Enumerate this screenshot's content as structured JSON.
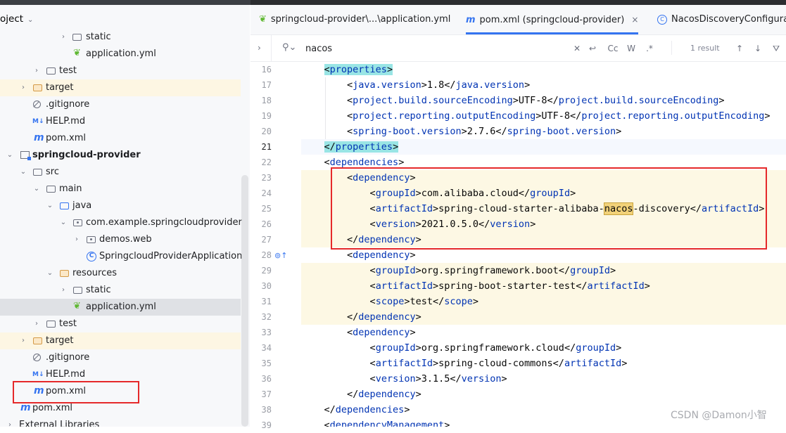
{
  "project_panel": {
    "title": "oject",
    "rows": [
      {
        "label": "static",
        "icon": "folder-icon",
        "arrow": "›"
      },
      {
        "label": "application.yml",
        "icon": "yaml-icon",
        "arrow": ""
      },
      {
        "label": "test",
        "icon": "folder-icon",
        "arrow": "›"
      },
      {
        "label": "target",
        "icon": "excluded-folder-icon",
        "arrow": "›"
      },
      {
        "label": ".gitignore",
        "icon": "ignore-icon",
        "arrow": ""
      },
      {
        "label": "HELP.md",
        "icon": "markdown-icon",
        "arrow": ""
      },
      {
        "label": "pom.xml",
        "icon": "maven-icon",
        "arrow": ""
      },
      {
        "label": "springcloud-provider",
        "icon": "module-icon",
        "arrow": "⌄"
      },
      {
        "label": "src",
        "icon": "folder-icon",
        "arrow": "⌄"
      },
      {
        "label": "main",
        "icon": "folder-icon",
        "arrow": "⌄"
      },
      {
        "label": "java",
        "icon": "source-folder-icon",
        "arrow": "⌄"
      },
      {
        "label": "com.example.springcloudprovider",
        "icon": "package-icon",
        "arrow": "⌄"
      },
      {
        "label": "demos.web",
        "icon": "package-icon",
        "arrow": "›"
      },
      {
        "label": "SpringcloudProviderApplication",
        "icon": "class-icon",
        "arrow": ""
      },
      {
        "label": "resources",
        "icon": "resources-folder-icon",
        "arrow": "⌄"
      },
      {
        "label": "static",
        "icon": "folder-icon",
        "arrow": "›"
      },
      {
        "label": "application.yml",
        "icon": "yaml-icon",
        "arrow": ""
      },
      {
        "label": "test",
        "icon": "folder-icon",
        "arrow": "›"
      },
      {
        "label": "target",
        "icon": "excluded-folder-icon",
        "arrow": "›"
      },
      {
        "label": ".gitignore",
        "icon": "ignore-icon",
        "arrow": ""
      },
      {
        "label": "HELP.md",
        "icon": "markdown-icon",
        "arrow": ""
      },
      {
        "label": "pom.xml",
        "icon": "maven-icon",
        "arrow": ""
      },
      {
        "label": "pom.xml",
        "icon": "maven-icon",
        "arrow": ""
      },
      {
        "label": "External Libraries",
        "icon": "library-icon",
        "arrow": "›"
      }
    ]
  },
  "tabs": [
    {
      "label": "springcloud-provider\\...\\application.yml",
      "icon": "yaml-icon"
    },
    {
      "label": "pom.xml (springcloud-provider)",
      "icon": "maven-icon",
      "close": "×"
    },
    {
      "label": "NacosDiscoveryConfigura",
      "icon": "class-icon"
    }
  ],
  "search": {
    "value": "nacos",
    "result_count": "1 result",
    "case_btn": "Cc",
    "word_btn": "W",
    "regex_btn": ".*"
  },
  "editor": {
    "line_numbers": [
      "16",
      "17",
      "18",
      "19",
      "20",
      "21",
      "22",
      "23",
      "24",
      "25",
      "26",
      "27",
      "28",
      "29",
      "30",
      "31",
      "32",
      "33",
      "34",
      "35",
      "36",
      "37",
      "38",
      "39"
    ],
    "current_line": "21"
  },
  "watermark": "CSDN @Damon小智",
  "colors": {
    "accent": "#3574f0",
    "tag": "#0033b3",
    "highlight_box": "#e5292a",
    "find_match": "#f2d279"
  }
}
